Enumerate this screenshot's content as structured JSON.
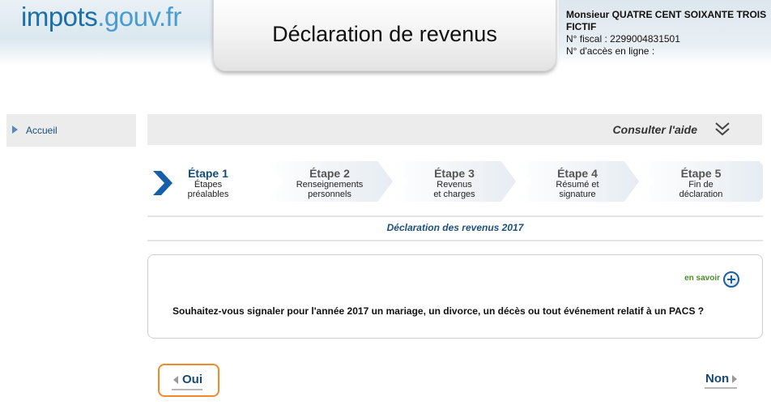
{
  "header": {
    "logo_part1": "impots",
    "logo_part2": ".gouv.fr",
    "title": "Déclaration de revenus",
    "user_name": "Monsieur QUATRE CENT SOIXANTE TROIS FICTIF",
    "fiscal_number": "N° fiscal : 2299004831501",
    "access_number": "N° d'accès en ligne :"
  },
  "sidebar": {
    "items": [
      {
        "label": "Accueil"
      }
    ]
  },
  "help": {
    "label": "Consulter l'aide"
  },
  "steps": [
    {
      "num": "Étape 1",
      "line1": "Étapes",
      "line2": "préalables",
      "active": true
    },
    {
      "num": "Étape 2",
      "line1": "Renseignements",
      "line2": "personnels",
      "active": false
    },
    {
      "num": "Étape 3",
      "line1": "Revenus",
      "line2": "et charges",
      "active": false
    },
    {
      "num": "Étape 4",
      "line1": "Résumé et",
      "line2": "signature",
      "active": false
    },
    {
      "num": "Étape 5",
      "line1": "Fin de",
      "line2": "déclaration",
      "active": false
    }
  ],
  "section": {
    "title": "Déclaration des revenus 2017"
  },
  "card": {
    "more_link": "en savoir",
    "question": "Souhaitez-vous signaler pour l'année 2017 un mariage, un divorce, un décès ou tout événement relatif à un PACS ?"
  },
  "answers": {
    "yes_label": "Oui",
    "no_label": "Non"
  },
  "colors": {
    "brand_blue": "#17497a",
    "highlight_orange": "#f08a2b",
    "link_green": "#4c8c2a"
  }
}
